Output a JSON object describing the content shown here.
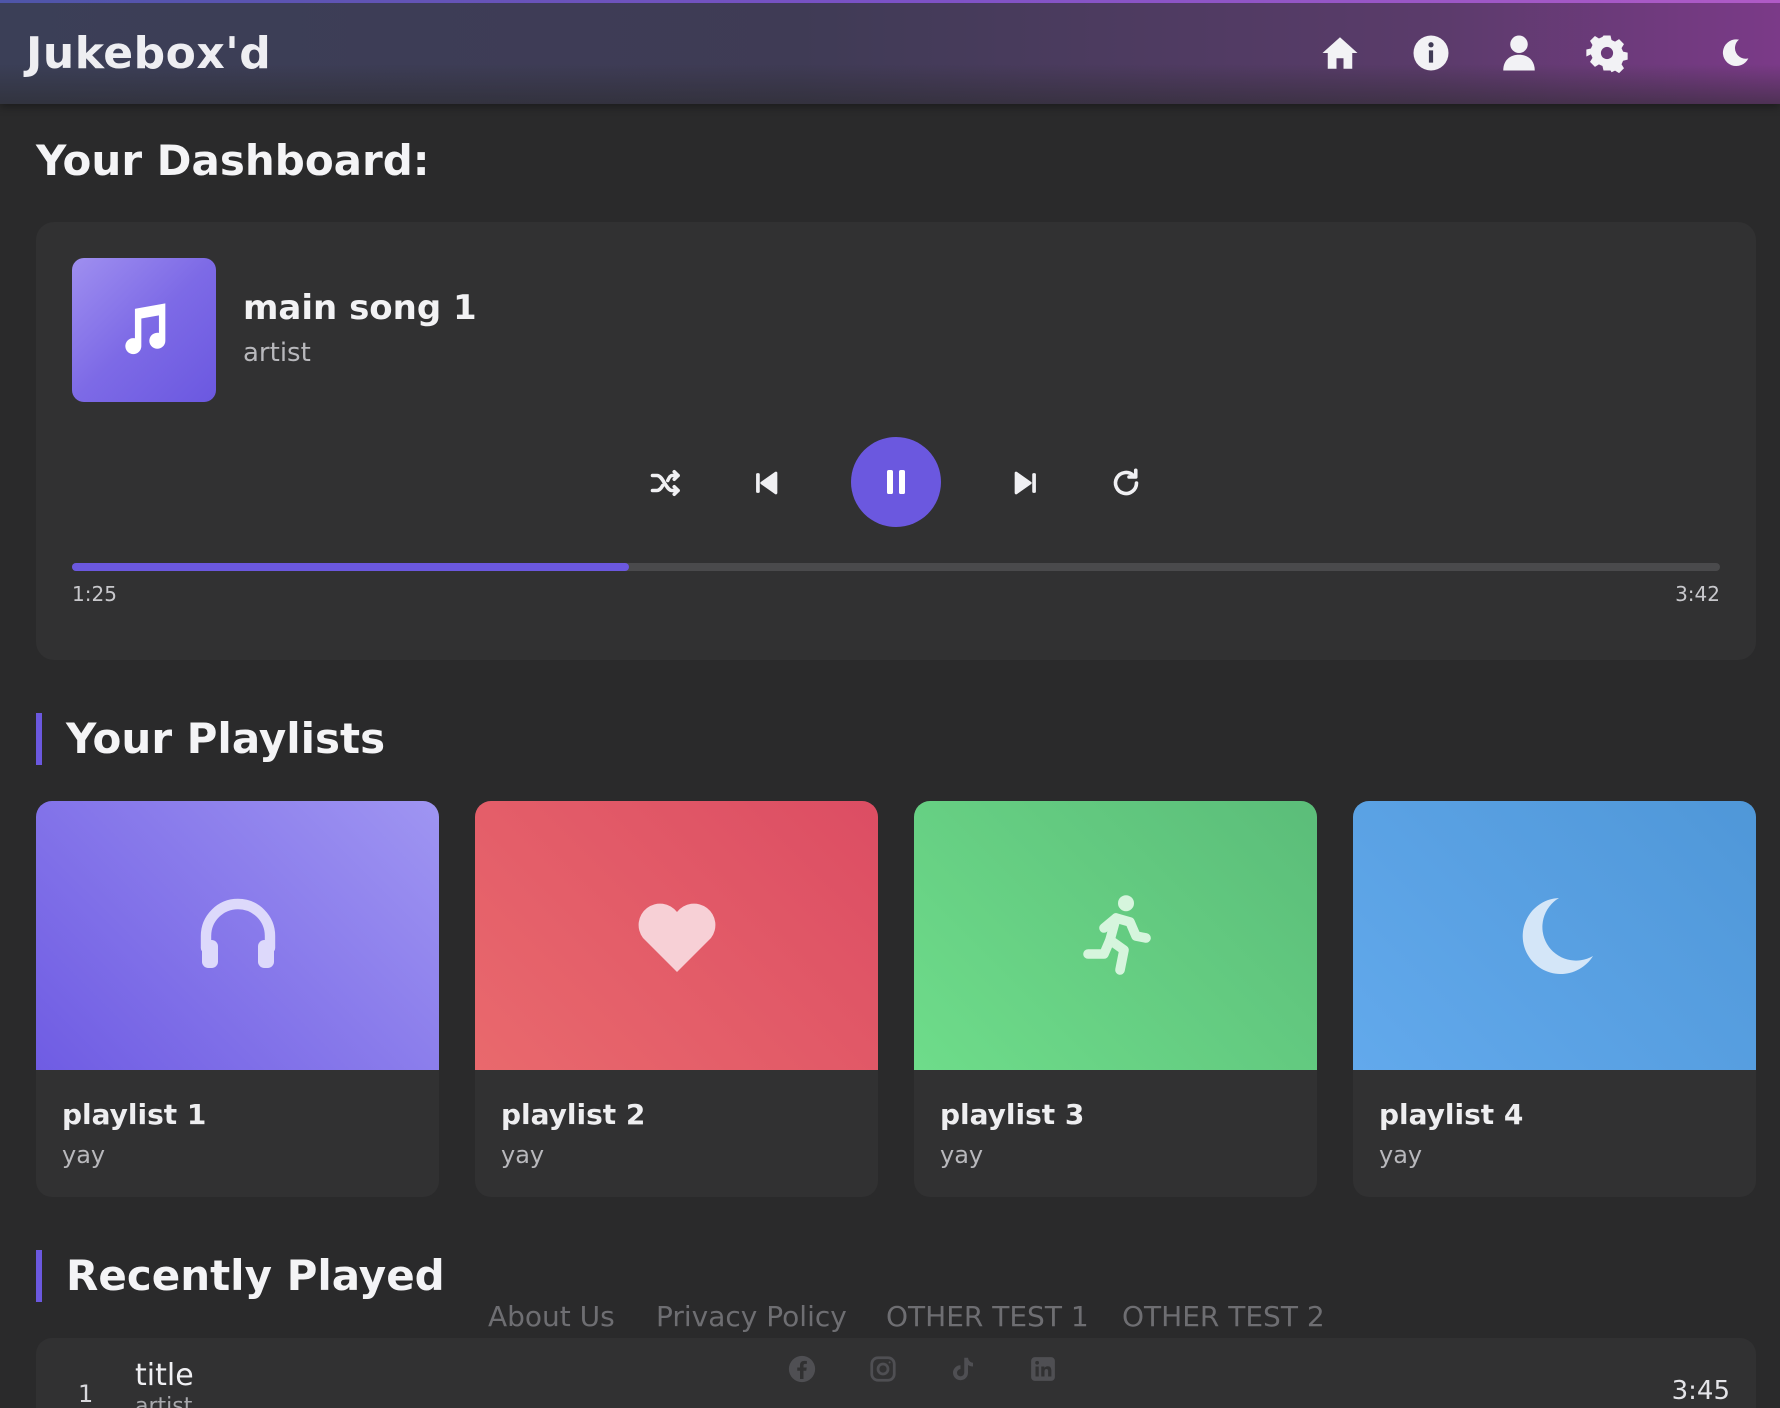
{
  "header": {
    "brand": "Jukebox'd",
    "nav": [
      "home-icon",
      "info-icon",
      "user-icon",
      "settings-icon",
      "moon-icon"
    ]
  },
  "dashboard": {
    "title": "Your Dashboard:"
  },
  "player": {
    "cover_icon": "music-note-icon",
    "song_title": "main song 1",
    "artist": "artist",
    "controls": [
      "shuffle-icon",
      "previous-icon",
      "pause-icon",
      "next-icon",
      "repeat-icon"
    ],
    "current_time": "1:25",
    "total_time": "3:42",
    "progress": 0.3378,
    "accent_color": "#6b58df"
  },
  "playlists": {
    "title": "Your Playlists",
    "items": [
      {
        "name": "playlist 1",
        "desc": "yay",
        "icon": "headphones-icon",
        "color_start": "#6f5ce3",
        "color_end": "#9f95f2"
      },
      {
        "name": "playlist 2",
        "desc": "yay",
        "icon": "heart-icon",
        "color_start": "#e9696d",
        "color_end": "#dc4d63"
      },
      {
        "name": "playlist 3",
        "desc": "yay",
        "icon": "running-icon",
        "color_start": "#6edc8a",
        "color_end": "#5bbd79"
      },
      {
        "name": "playlist 4",
        "desc": "yay",
        "icon": "moon-icon",
        "color_start": "#62a9ec",
        "color_end": "#4f97d8"
      }
    ]
  },
  "recent": {
    "title": "Recently Played",
    "rows": [
      {
        "num": "1",
        "title": "title",
        "artist": "artist",
        "duration": "3:45"
      }
    ]
  },
  "footer": {
    "links": [
      "About Us",
      "Privacy Policy",
      "OTHER TEST 1",
      "OTHER TEST 2"
    ],
    "socials": [
      "facebook-icon",
      "instagram-icon",
      "tiktok-icon",
      "linkedin-icon"
    ]
  }
}
